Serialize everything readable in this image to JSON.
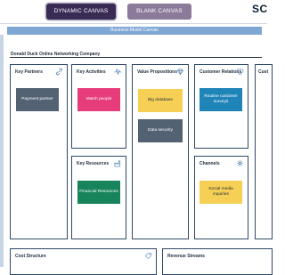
{
  "toolbar": {
    "dynamic_canvas_label": "DYNAMIC CANVAS",
    "blank_canvas_label": "BLANK CANVAS",
    "brand_text": "SC"
  },
  "canvas": {
    "title": "Business Model Canvas",
    "company": "Donald Duck Online Networking Company"
  },
  "blocks": {
    "key_partners": {
      "title": "Key Partners",
      "notes": [
        "Payment partner"
      ]
    },
    "key_activities": {
      "title": "Key Activities",
      "notes": [
        "Match people"
      ]
    },
    "key_resources": {
      "title": "Key Resources",
      "notes": [
        "Financial Resources"
      ]
    },
    "value_propositions": {
      "title": "Value Propositions",
      "notes": [
        "Big database",
        "Data security"
      ]
    },
    "customer_relations": {
      "title": "Customer Relations",
      "notes": [
        "Routine customer surveys"
      ]
    },
    "channels": {
      "title": "Channels",
      "notes": [
        "Social media inquiries"
      ]
    },
    "customer_segments": {
      "title": "Cust"
    },
    "cost_structure": {
      "title": "Cost Structure"
    },
    "revenue_streams": {
      "title": "Revenue Streams"
    }
  },
  "colors": {
    "dynamic_tab": "#3a2b55",
    "blank_tab": "#8b7a99",
    "header_bar": "#7ea7d3",
    "border": "#2f4a68",
    "note_dark": "#536272",
    "note_pink": "#e63c7b",
    "note_yellow": "#f6cf55",
    "note_blue": "#1f84b8",
    "note_green": "#17845c"
  }
}
